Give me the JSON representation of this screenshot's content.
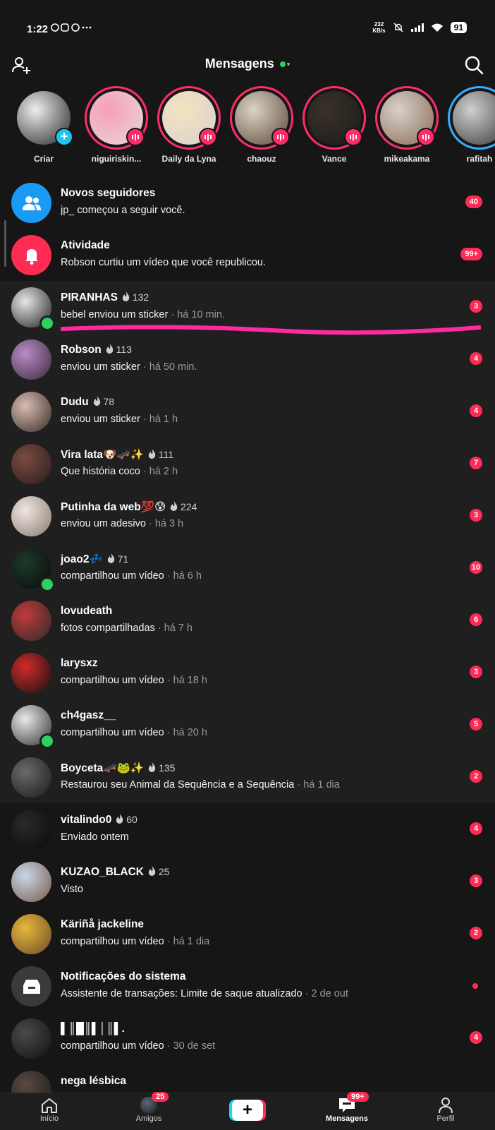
{
  "status_bar": {
    "time": "1:22",
    "network_speed": "232",
    "network_unit": "KB/s",
    "battery": "91"
  },
  "header": {
    "title": "Mensagens"
  },
  "stories": [
    {
      "name": "Criar",
      "ring": "none",
      "colors": [
        "#eeeeee",
        "#222222"
      ]
    },
    {
      "name": "niguiriskin...",
      "ring": "pink",
      "colors": [
        "#f6a0b8",
        "#e8d6d6"
      ]
    },
    {
      "name": "Daily da Lyna",
      "ring": "pink",
      "colors": [
        "#f3e3c0",
        "#d9d2cc"
      ]
    },
    {
      "name": "chaouz",
      "ring": "pink",
      "colors": [
        "#dcd2c4",
        "#5a4a3a"
      ]
    },
    {
      "name": "Vance",
      "ring": "pink",
      "colors": [
        "#3a3228",
        "#1a1a1a"
      ]
    },
    {
      "name": "mikeakama",
      "ring": "pink",
      "colors": [
        "#d8d2cb",
        "#8a6a55"
      ]
    },
    {
      "name": "rafitah",
      "ring": "blue",
      "colors": [
        "#cfcfcf",
        "#3a3a3a"
      ]
    }
  ],
  "system_rows": [
    {
      "title": "Novos seguidores",
      "subtitle": "jp_ começou a seguir você.",
      "badge": "40",
      "icon": "people-icon",
      "icon_bg": "#1a9af5"
    },
    {
      "title": "Atividade",
      "subtitle": "Robson curtiu um vídeo que você republicou.",
      "badge": "99+",
      "icon": "bell-icon",
      "icon_bg": "#fe2c55"
    }
  ],
  "chats": [
    {
      "name": "PIRANHAS",
      "streak": "132",
      "message": "bebel enviou um sticker",
      "time": "há 10 min.",
      "badge": "3",
      "online": true,
      "colors": [
        "#e6e6e6",
        "#222222"
      ]
    },
    {
      "name": "Robson",
      "streak": "113",
      "message": "enviou um sticker",
      "time": "há 50 min.",
      "badge": "4",
      "online": false,
      "colors": [
        "#b88cc7",
        "#3a2a3a"
      ]
    },
    {
      "name": "Dudu",
      "streak": "78",
      "message": "enviou um sticker",
      "time": "há 1 h",
      "badge": "4",
      "online": false,
      "colors": [
        "#d6bdb2",
        "#3a2a26"
      ]
    },
    {
      "name": "Vira lata🐶🛹✨",
      "streak": "111",
      "message": "Que história coco",
      "time": "há 2 h",
      "badge": "7",
      "online": false,
      "colors": [
        "#7a4a40",
        "#2a1e1c"
      ]
    },
    {
      "name": "Putinha da web💯😰",
      "streak": "224",
      "message": "enviou um adesivo",
      "time": "há 3 h",
      "badge": "3",
      "online": false,
      "colors": [
        "#efe6e0",
        "#8a7a72"
      ]
    },
    {
      "name": "joao2💤",
      "streak": "71",
      "message": "compartilhou um vídeo",
      "time": "há 6 h",
      "badge": "10",
      "online": true,
      "colors": [
        "#1e3a2a",
        "#0a0a0a"
      ]
    },
    {
      "name": "lovudeath",
      "streak": "",
      "message": "fotos compartilhadas",
      "time": "há 7 h",
      "badge": "6",
      "online": false,
      "colors": [
        "#c23a3a",
        "#2a2a2a"
      ]
    },
    {
      "name": "larysxz",
      "streak": "",
      "message": "compartilhou um vídeo",
      "time": "há 18 h",
      "badge": "3",
      "online": false,
      "colors": [
        "#d22a2a",
        "#111111"
      ]
    },
    {
      "name": "ch4gasz__",
      "streak": "",
      "message": "compartilhou um vídeo",
      "time": "há 20 h",
      "badge": "5",
      "online": true,
      "colors": [
        "#e8e8e8",
        "#333333"
      ]
    },
    {
      "name": "Boyceta🛹🐸✨",
      "streak": "135",
      "message": "Restaurou seu Animal da Sequência e a Sequência",
      "time": "há 1 dia",
      "badge": "2",
      "online": false,
      "colors": [
        "#6a6a6a",
        "#1a1a1a"
      ]
    },
    {
      "name": "vitalindo0",
      "streak": "60",
      "message": "Enviado ontem",
      "time": "",
      "badge": "4",
      "online": false,
      "colors": [
        "#2a2a2a",
        "#0a0a0a"
      ]
    },
    {
      "name": "KUZAO_BLACK",
      "streak": "25",
      "message": "Visto",
      "time": "",
      "badge": "3",
      "online": false,
      "colors": [
        "#c8d6e8",
        "#7a5a4a"
      ]
    },
    {
      "name": "Käriñå jackeline",
      "streak": "",
      "message": "compartilhou um vídeo",
      "time": "há 1 dia",
      "badge": "2",
      "online": false,
      "colors": [
        "#e8b83a",
        "#6a4a2a"
      ]
    },
    {
      "name": "Notificações do sistema",
      "streak": "",
      "message": "Assistente de transações: Limite de saque atualizado",
      "time": "2 de out",
      "badge": "",
      "online": false,
      "colors": [
        "#3a3a3a",
        "#3a3a3a"
      ]
    },
    {
      "name": "▌║█║▌│║▌.",
      "streak": "",
      "message": "compartilhou um vídeo",
      "time": "30 de set",
      "badge": "4",
      "online": false,
      "colors": [
        "#4a4a4a",
        "#111111"
      ]
    },
    {
      "name": "nega lésbica",
      "streak": "",
      "message": "",
      "time": "",
      "badge": "",
      "online": false,
      "colors": [
        "#5a4a40",
        "#1a1a1a"
      ]
    }
  ],
  "bottom_nav": [
    {
      "label": "Início",
      "badge": ""
    },
    {
      "label": "Amigos",
      "badge": "25"
    },
    {
      "label": "",
      "badge": ""
    },
    {
      "label": "Mensagens",
      "badge": "99+"
    },
    {
      "label": "Perfil",
      "badge": ""
    }
  ],
  "colors": {
    "background": "#161616",
    "accent": "#fe2c55",
    "online": "#2ed15e",
    "highlight_row": "#1f1f1f"
  }
}
